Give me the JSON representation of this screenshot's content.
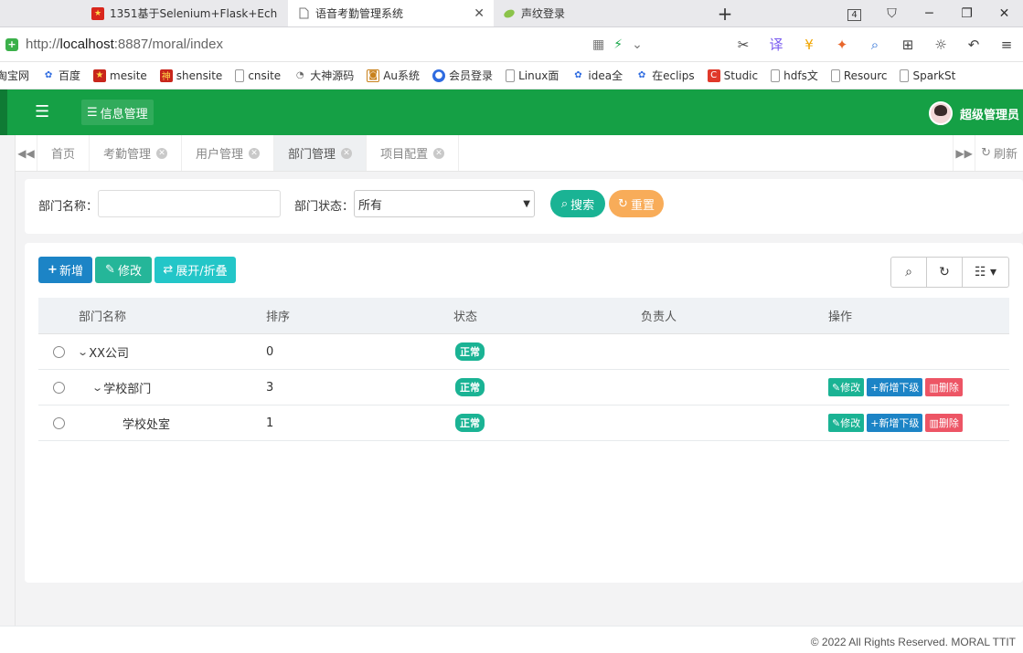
{
  "browser": {
    "tabs": [
      {
        "label": "1351基于Selenium+Flask+Ech",
        "icon": "app-icon"
      },
      {
        "label": "语音考勤管理系统",
        "icon": "document-icon"
      },
      {
        "label": "声纹登录",
        "icon": "leaf-icon"
      }
    ],
    "tab_count": "4",
    "url_prefix": "http://",
    "url_host": "localhost",
    "url_rest": ":8887/moral/index",
    "bookmarks": [
      "淘宝网",
      "百度",
      "mesite",
      "shensite",
      "cnsite",
      "大神源码",
      "Au系统",
      "会员登录",
      "Linux面",
      "idea全",
      "在eclips",
      "Studic",
      "hdfs文",
      "Resourc",
      "SparkSt"
    ]
  },
  "header": {
    "menu_label": "信息管理",
    "user_name": "超级管理员",
    "accent_color": "#15a045"
  },
  "page_tabs": {
    "items": [
      "首页",
      "考勤管理",
      "用户管理",
      "部门管理",
      "项目配置"
    ],
    "active": "部门管理",
    "refresh_label": "刷新"
  },
  "search": {
    "dept_name_label": "部门名称：",
    "dept_name_value": "",
    "dept_status_label": "部门状态：",
    "dept_status_value": "所有",
    "search_btn": "搜索",
    "reset_btn": "重置"
  },
  "toolbar": {
    "add_btn": "新增",
    "edit_btn": "修改",
    "expand_btn": "展开/折叠"
  },
  "table": {
    "columns": [
      "部门名称",
      "排序",
      "状态",
      "负责人",
      "操作"
    ],
    "rows": [
      {
        "name": "XX公司",
        "sort": "0",
        "status": "正常",
        "owner": "",
        "level": 0,
        "expanded": true
      },
      {
        "name": "学校部门",
        "sort": "3",
        "status": "正常",
        "owner": "",
        "level": 1,
        "expanded": true
      },
      {
        "name": "学校处室",
        "sort": "1",
        "status": "正常",
        "owner": "",
        "level": 2,
        "expanded": false
      }
    ],
    "op_edit": "修改",
    "op_add_sub": "新增下级",
    "op_delete": "删除"
  },
  "footer": {
    "copyright": "© 2022 All Rights Reserved. MORAL TTIT"
  }
}
